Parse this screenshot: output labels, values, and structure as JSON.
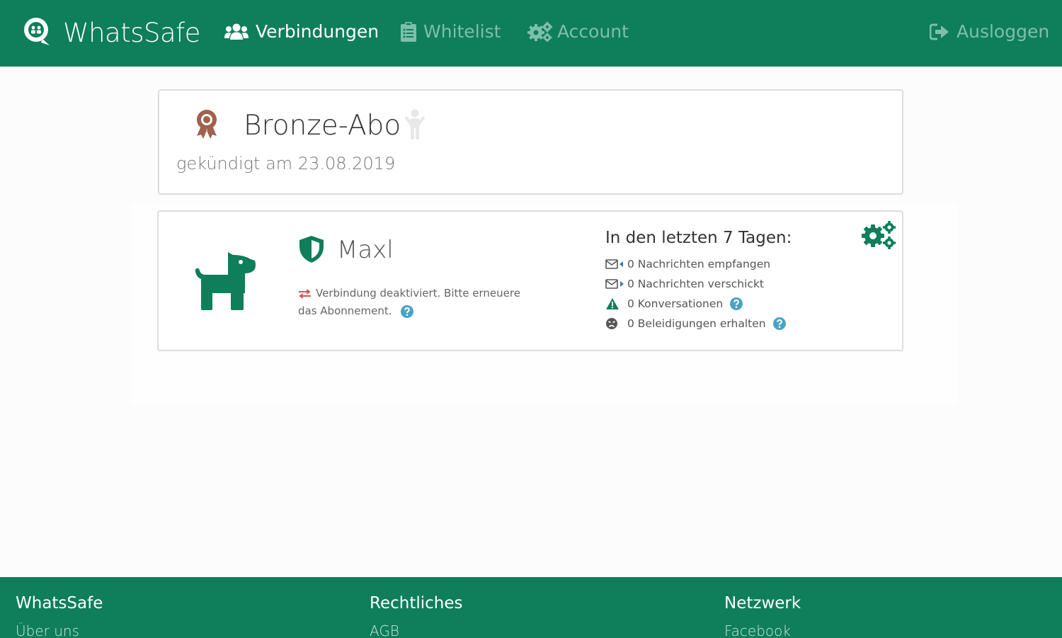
{
  "app": {
    "name": "WhatsSafe"
  },
  "nav": {
    "items": [
      {
        "label": "Verbindungen",
        "icon": "users-icon",
        "active": true
      },
      {
        "label": "Whitelist",
        "icon": "clipboard-list-icon",
        "active": false
      },
      {
        "label": "Account",
        "icon": "cogs-icon",
        "active": false
      }
    ],
    "logout": {
      "label": "Ausloggen",
      "icon": "sign-out-icon"
    }
  },
  "subscription": {
    "title": "Bronze-Abo",
    "status": "gekündigt am 23.08.2019",
    "medal_color": "#a0614e",
    "icon": "award-icon",
    "child_icon": "child-icon"
  },
  "connection": {
    "name": "Maxl",
    "avatar_icon": "dog-icon",
    "shield_icon": "shield-icon",
    "warning": "Verbindung deaktiviert. Bitte erneuere das Abonnement.",
    "stats": {
      "title": "In den letzten 7 Tagen:",
      "items": [
        {
          "text": "0 Nachrichten empfangen",
          "icon": "envelope-in-icon",
          "help": false
        },
        {
          "text": "0 Nachrichten verschickt",
          "icon": "envelope-out-icon",
          "help": false
        },
        {
          "text": "0 Konversationen",
          "icon": "warning-icon",
          "help": true
        },
        {
          "text": "0 Beleidigungen erhalten",
          "icon": "angry-face-icon",
          "help": true
        }
      ]
    },
    "settings_icon": "cogs-icon"
  },
  "footer": {
    "columns": [
      {
        "heading": "WhatsSafe",
        "link": "Über uns"
      },
      {
        "heading": "Rechtliches",
        "link": "AGB"
      },
      {
        "heading": "Netzwerk",
        "link": "Facebook"
      }
    ]
  },
  "colors": {
    "brand_green": "#0e7e5b",
    "nav_dim": "#7fbfa9",
    "warning_red": "#d9534f",
    "help_blue": "#4aa3c5"
  }
}
